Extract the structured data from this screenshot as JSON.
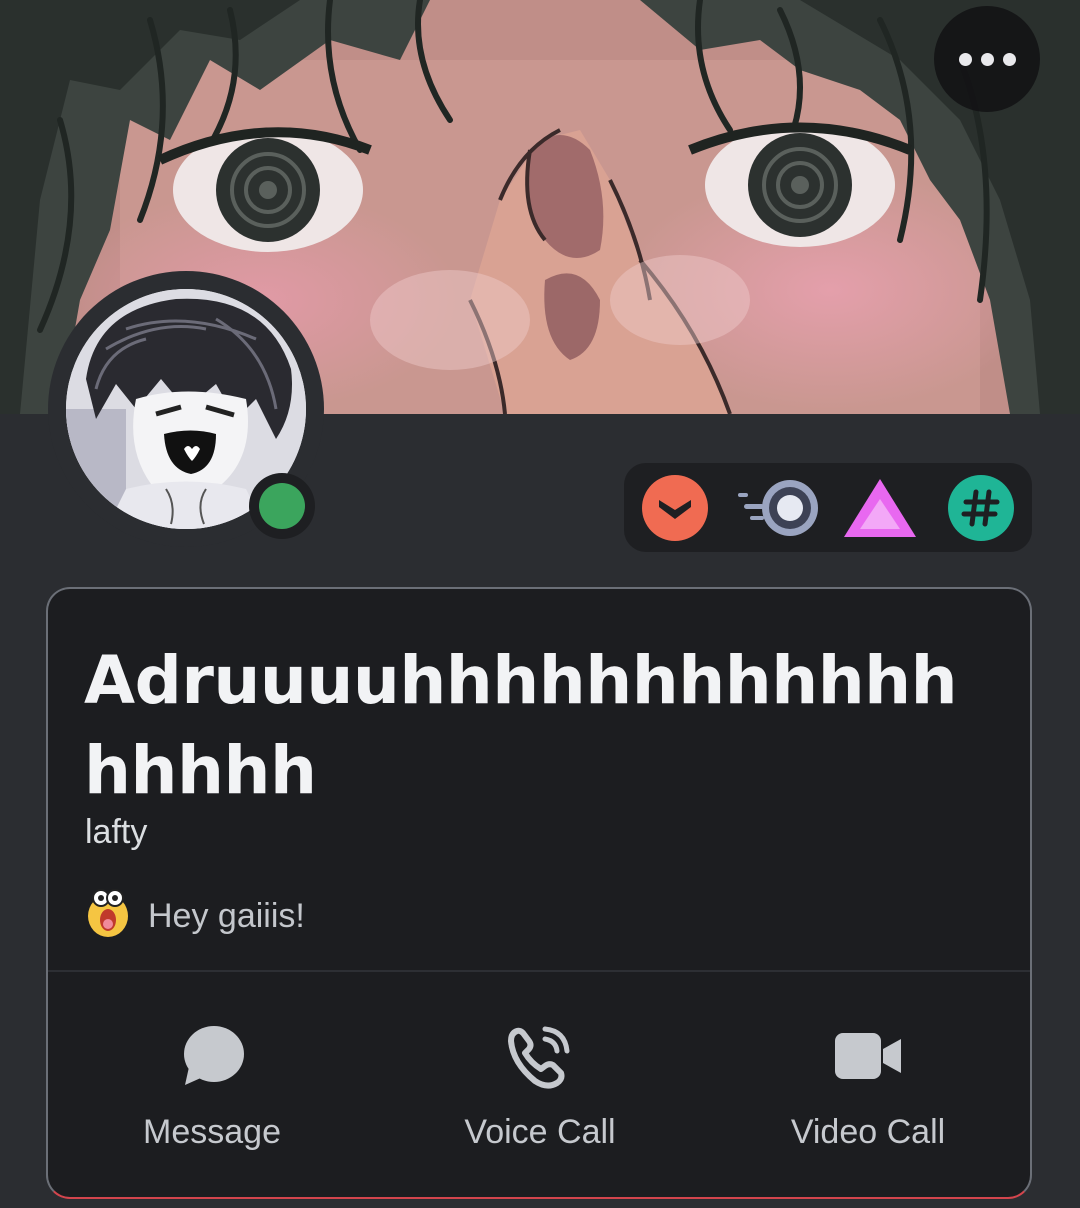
{
  "header": {
    "more_icon": "more-horizontal-icon"
  },
  "profile": {
    "display_name": "Adruuuuhhhhhhhhhhhhhhhhh",
    "username": "lafty",
    "online_status_color": "#3ba55d",
    "custom_status": {
      "emoji_icon": "screaming-face-emoji-icon",
      "text": "Hey gaiiis!"
    }
  },
  "badges": [
    {
      "icon": "bug-hunter-badge-icon",
      "color": "#f06b52"
    },
    {
      "icon": "nitro-boost-badge-icon",
      "color": "#9aa4c0"
    },
    {
      "icon": "triangle-badge-icon",
      "color": "#e868f0"
    },
    {
      "icon": "hashtag-badge-icon",
      "color": "#1fb596"
    }
  ],
  "actions": [
    {
      "label": "Message",
      "icon": "chat-bubble-icon"
    },
    {
      "label": "Voice Call",
      "icon": "phone-call-icon"
    },
    {
      "label": "Video Call",
      "icon": "video-camera-icon"
    }
  ],
  "colors": {
    "background": "#2b2d31",
    "card": "#1c1d20",
    "card_border": "#6b6f77",
    "accent_border": "#d3454d",
    "text_primary": "#f2f3f5",
    "text_muted": "#c6c9ce"
  }
}
